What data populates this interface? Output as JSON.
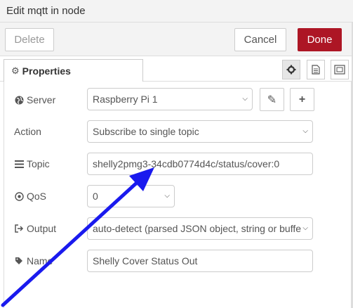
{
  "dialog": {
    "title": "Edit mqtt in node"
  },
  "toolbar": {
    "delete_label": "Delete",
    "cancel_label": "Cancel",
    "done_label": "Done"
  },
  "tabs": {
    "properties_label": "Properties",
    "properties_icon": "gear-icon"
  },
  "side_buttons": [
    "gear-icon",
    "document-icon",
    "frame-icon"
  ],
  "form": {
    "server": {
      "label": "Server",
      "value": "Raspberry Pi 1",
      "icon": "globe-icon"
    },
    "action": {
      "label": "Action",
      "value": "Subscribe to single topic"
    },
    "topic": {
      "label": "Topic",
      "value": "shelly2pmg3-34cdb0774d4c/status/cover:0",
      "icon": "tasks-icon"
    },
    "qos": {
      "label": "QoS",
      "value": "0",
      "icon": "qos-icon"
    },
    "output": {
      "label": "Output",
      "value": "auto-detect (parsed JSON object, string or buffe",
      "icon": "sign-out-icon"
    },
    "name": {
      "label": "Name",
      "value": "Shelly Cover Status Out",
      "icon": "tag-icon"
    }
  },
  "colors": {
    "done": "#ad1625",
    "annotation_arrow": "#1a1aee"
  }
}
